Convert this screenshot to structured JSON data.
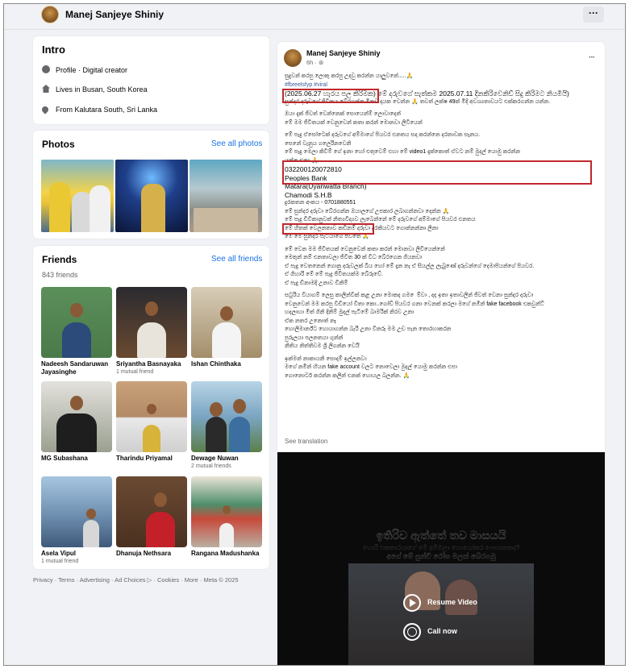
{
  "header": {
    "name": "Manej Sanjeye Shiniy",
    "more_label": "···"
  },
  "intro": {
    "title": "Intro",
    "items": [
      {
        "icon": "info-icon",
        "text": "Profile · Digital creator"
      },
      {
        "icon": "home-icon",
        "text": "Lives in Busan, South Korea"
      },
      {
        "icon": "location-pin-icon",
        "text": "From Kalutara South, Sri Lanka"
      }
    ]
  },
  "photos": {
    "title": "Photos",
    "link": "See all photos"
  },
  "friends": {
    "title": "Friends",
    "link": "See all friends",
    "count": "843 friends",
    "list": [
      {
        "name": "Nadeesh Sandaruwan Jayasinghe",
        "mutual": ""
      },
      {
        "name": "Sriyantha Basnayaka",
        "mutual": "1 mutual friend"
      },
      {
        "name": "Ishan Chinthaka",
        "mutual": ""
      },
      {
        "name": "MG Subashana",
        "mutual": ""
      },
      {
        "name": "Tharindu Priyamal",
        "mutual": ""
      },
      {
        "name": "Dewage Nuwan",
        "mutual": "2 mutual friends"
      },
      {
        "name": "Asela Vipul",
        "mutual": "1 mutual friend"
      },
      {
        "name": "Dhanuja Nethsara",
        "mutual": ""
      },
      {
        "name": "Rangana Madushanka",
        "mutual": ""
      }
    ]
  },
  "footer": "Privacy · Terms · Advertising · Ad Choices ▷ · Cookies · More · Meta © 2025",
  "post": {
    "author": "Manej Sanjeye Shiniy",
    "meta": "6h · ⊛",
    "more_label": "···",
    "lines": [
      "සුදුවන් කරපු ලොකු කරපු උදවු කරන්න යාලුවනේ.....🙏",
      "#fbreelsfyp #viral",
      "(2025.06.27 හැරය පල කිරිමක) මේ දරුවගේ සැත්කම 2025.07.11 දිනකිරිවෙනිඩ් සිදු කිරිමට නියමියි)",
      "සුන්දර දරුවගේ ජිවිතය බේරගන්න මිනව දායක වෙන්න 🙏 තවත් ලක්ෂ 49ක් මිදි අවශ්‍යතාවයට එක්කරගන්න යන්න.",
      "",
      "ඔයා දැක් ජිවත් වෙන්නෙක් සොයෙන්ම් ලොවාදෙන්",
      "මේ මම ජිවිතයක් වෙනුවෙන් කතා කරන් මොනවා ලිවියෙන්",
      "",
      "මේ පැදු ඒසෝටෙක් දරුවගේ අම්මාගේ පියවර එනතය සදා කරන්නෙ දරනාවක සෑනය.",
      "සෙනේ වැනුය ගලෙරිනවෙනි",
      "මේ පැදු මෙලා කිවිම් ගේ ඉනා හෝ එතුවෙම් එහා මේ video1 දැක්කොත් ඒවට නම් මුදල් යොමු කරන්න",
      "යන්න එනා 🙏",
      "032200120072810",
      "Peoples Bank",
      "Matara(Uyanwatta Branch)",
      "Chamodi S.H.B",
      "දුරකතන අංකය - 0701880551",
      "මේ සුන්දර දරුවා බේරගන්න ඔයාලගේ උපකාර ලබාගන්නවා දෙන්න 🙏",
      "මේ පැදු ඩිවිකානුවක් නිත්‍යවිද්‍යව ලැබෙන්නේ මේ දරුවගේ අම්මාගේ පියවර එනතය",
      "මේ හිතක් වෙලනතාව කඩිනම් දරුවා දුරකියවට ගොන්නන්නා ලිනා",
      "මේ මේ සුන්දර පැටියාගේ ජිවිතේ 🙏",
      "",
      "මේ වෙන මම ජිවිතයක් වෙනුවෙන් කතා කරන් මොනවා ලිවියෙන්නේ",
      "මෙතුන් නම් එනතාවලා ජිවිත 30 ක් විධ බේරගෙන ගියනවා",
      "ඒ පැදු වෙතනෙන් ගොනු දරුවලක් බිය හෝ මේ දැන නැ ඒ සියල්ල ලැබුණේ දරුවන්ගේ දෙමාපියන්ගේ පියවර.",
      "ඒ ගිහාරි මේ මේ පැදු ජිවිතයක්ම බේරුවේ.",
      "ඒ පැදු ඩිනාමදි උනාව ඩිනිම්",
      "",
      "සටුරිය වියාගම් ලෙසු කාලින්වීක් කළ උනා මොකද ගම ෙම්වා , දද ඉතා ඉතාවලින් ජිවත් වෙනා සුන්දර දරුවා",
      "වෙනුවෙන් මම කරපු වීඩියෝ විතා කො..ගෝඩ් පියවර ගනා වෙනක් කරලා මගේ නමින් fake facebook එකවුන්ට්",
      "හදලාහා මිත් ගිනි දිනිම් මුදල් පැටිමේ බාමරික් නිරව උනා",
      "ඒක නතර උනොත් නෑ",
      "හොලිමාර්න්ට හොයාගන්න බැරි උනා විනරු මම උඩ පැන තොරහාකරන",
      "පුරුලයා පලනතයා ගුන්න්",
      "නිතිය නිත්තිවම ශ්‍රී ලිගන්න වෙයි",
      "",
      "ඉක්මන් නාකායනි සොදාම් ඉල්ලනවා",
      "මගේ නමින් හියන fake account වලට නොවෙලා මුදල් යොමු කරන්න එපා",
      "ගොනොර්ට කරන්න කලින් එනක් හොයල බලන්න. 🙏"
    ],
    "see_translation": "See translation"
  },
  "video": {
    "title": "ඉතිරිව ඇත්තේ තව මාසයයි",
    "subtitle1": "හොරි එකකාරයාගේ මේ අම්මලා හොයෝකර පොයානකද?",
    "subtitle2": "අගේ මේ පුන්චි රෝස මලක් බේරගමු",
    "resume_label": "Resume Video",
    "call_label": "Call now"
  },
  "colors": {
    "highlight_box": "#c1272d",
    "link": "#1b74e4",
    "hashtag": "#385898"
  }
}
